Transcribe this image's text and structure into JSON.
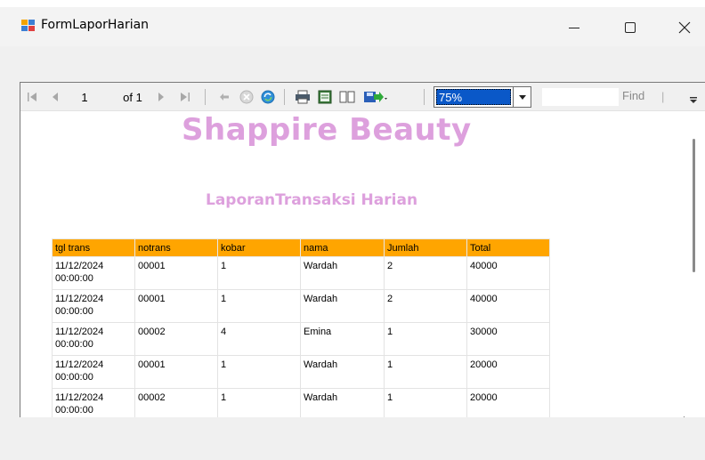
{
  "window": {
    "title": "FormLaporHarian",
    "minimize": "—",
    "maximize": "☐",
    "close": "✕"
  },
  "toolbar": {
    "page_current": "1",
    "page_of": "of 1",
    "zoom": "75%",
    "find": "Find",
    "find_sep": "|"
  },
  "report": {
    "title": "Shappire Beauty",
    "subtitle": "LaporanTransaksi Harian",
    "columns": [
      "tgl trans",
      "notrans",
      "kobar",
      "nama",
      "Jumlah",
      "Total"
    ],
    "rows": [
      [
        "11/12/2024 00:00:00",
        "00001",
        "1",
        "Wardah",
        "2",
        "40000"
      ],
      [
        "11/12/2024 00:00:00",
        "00001",
        "1",
        "Wardah",
        "2",
        "40000"
      ],
      [
        "11/12/2024 00:00:00",
        "00002",
        "4",
        "Emina",
        "1",
        "30000"
      ],
      [
        "11/12/2024 00:00:00",
        "00001",
        "1",
        "Wardah",
        "1",
        "20000"
      ],
      [
        "11/12/2024 00:00:00",
        "00002",
        "1",
        "Wardah",
        "1",
        "20000"
      ]
    ],
    "header_color": "#ffa500",
    "title_color": "#dda0dd"
  },
  "icons": [
    "first-page-icon",
    "prev-page-icon",
    "next-page-icon",
    "last-page-icon",
    "back-icon",
    "stop-icon",
    "refresh-icon",
    "print-icon",
    "print-layout-icon",
    "page-setup-icon",
    "export-icon"
  ]
}
